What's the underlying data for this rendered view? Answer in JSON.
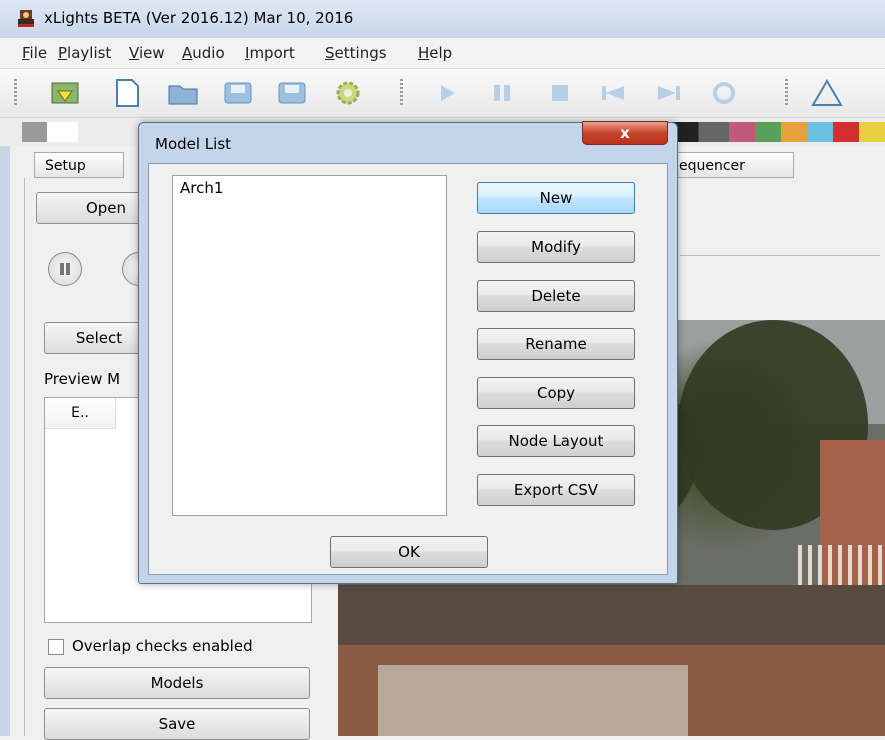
{
  "window": {
    "title": "xLights BETA (Ver 2016.12) Mar 10, 2016",
    "app_icon": "xlights-logo-icon"
  },
  "menubar": {
    "items": [
      "File",
      "Playlist",
      "View",
      "Audio",
      "Import",
      "Settings",
      "Help"
    ],
    "mnemonics": [
      "F",
      "P",
      "V",
      "A",
      "I",
      "S",
      "H"
    ]
  },
  "toolbar": {
    "icons": [
      "import-icon",
      "new-document-icon",
      "open-folder-icon",
      "save-icon",
      "save-as-icon",
      "render-gear-icon",
      "play-icon",
      "pause-icon",
      "stop-icon",
      "rewind-icon",
      "fast-forward-icon",
      "repeat-icon",
      "triangle-icon"
    ]
  },
  "tabs": {
    "setup": "Setup",
    "sequencer": "equencer"
  },
  "left_panel": {
    "open_button": "Open",
    "select_button": "Select",
    "preview_label": "Preview M",
    "column_header": "E..",
    "overlap_label": "Overlap checks enabled",
    "overlap_checked": false,
    "models_button": "Models",
    "save_button": "Save"
  },
  "dialog": {
    "title": "Model List",
    "close_label": "x",
    "models": [
      "Arch1"
    ],
    "buttons": {
      "new": "New",
      "modify": "Modify",
      "delete": "Delete",
      "rename": "Rename",
      "copy": "Copy",
      "node_layout": "Node Layout",
      "export_csv": "Export CSV"
    },
    "ok": "OK"
  },
  "colors": {
    "close_button": "#c9452d",
    "default_button_border": "#3c7fb1",
    "titlebar": "#c7d6ea"
  }
}
